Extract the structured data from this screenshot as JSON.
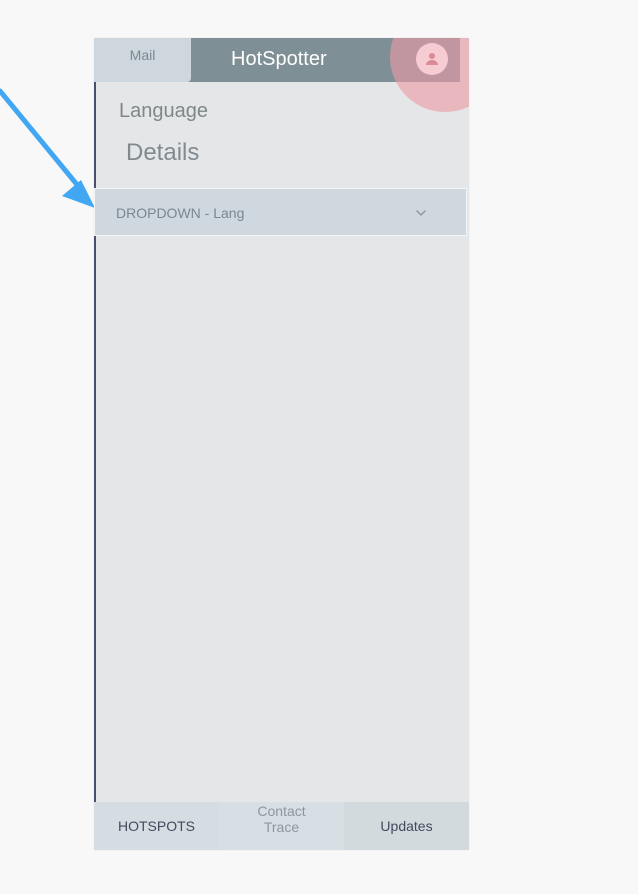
{
  "header": {
    "mail_label": "Mail",
    "title": "HotSpotter",
    "avatar_icon": "person-icon"
  },
  "content": {
    "section_label": "Language",
    "section_title": "Details",
    "dropdown": {
      "label": "DROPDOWN - Lang",
      "icon": "chevron-down-icon"
    }
  },
  "bottom_nav": [
    {
      "label": "HOTSPOTS"
    },
    {
      "label_line1": "Contact",
      "label_line2": "Trace"
    },
    {
      "label": "Updates"
    }
  ],
  "annotation": {
    "arrow_color": "#42a7f3"
  },
  "colors": {
    "page_background": "#f8f8f8",
    "screen_background": "#e5e6e8",
    "topbar": "#7f8f96",
    "highlight": "#ec9ba6",
    "nav_dark_text": "#44495d"
  }
}
